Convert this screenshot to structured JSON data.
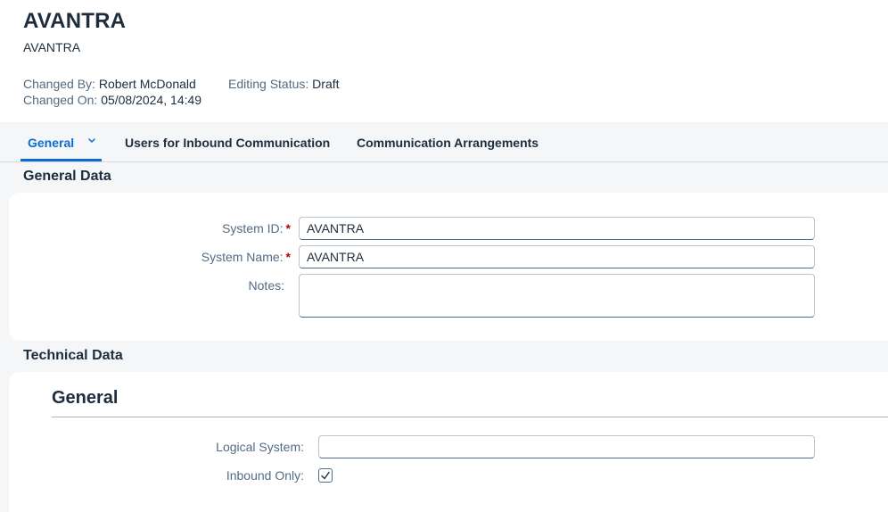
{
  "header": {
    "title": "AVANTRA",
    "subtitle": "AVANTRA",
    "changed_by_label": "Changed By:",
    "changed_by_value": "Robert McDonald",
    "changed_on_label": "Changed On:",
    "changed_on_value": "05/08/2024, 14:49",
    "editing_status_label": "Editing Status:",
    "editing_status_value": "Draft"
  },
  "tabs": [
    {
      "label": "General",
      "active": true,
      "icon": "chevron-down-icon"
    },
    {
      "label": "Users for Inbound Communication",
      "active": false
    },
    {
      "label": "Communication Arrangements",
      "active": false
    }
  ],
  "general_data": {
    "title": "General Data",
    "system_id_label": "System ID:",
    "system_id_value": "AVANTRA",
    "system_name_label": "System Name:",
    "system_name_value": "AVANTRA",
    "notes_label": "Notes:",
    "notes_value": "",
    "required_marker": "*"
  },
  "technical_data": {
    "title": "Technical Data",
    "subsection_title": "General",
    "logical_system_label": "Logical System:",
    "logical_system_value": "",
    "inbound_only_label": "Inbound Only:",
    "inbound_only_checked": true
  },
  "colors": {
    "accent": "#0a6ed1",
    "required": "#aa0808",
    "label": "#556b82",
    "text": "#1d2d3e",
    "background": "#f5f6f7"
  }
}
